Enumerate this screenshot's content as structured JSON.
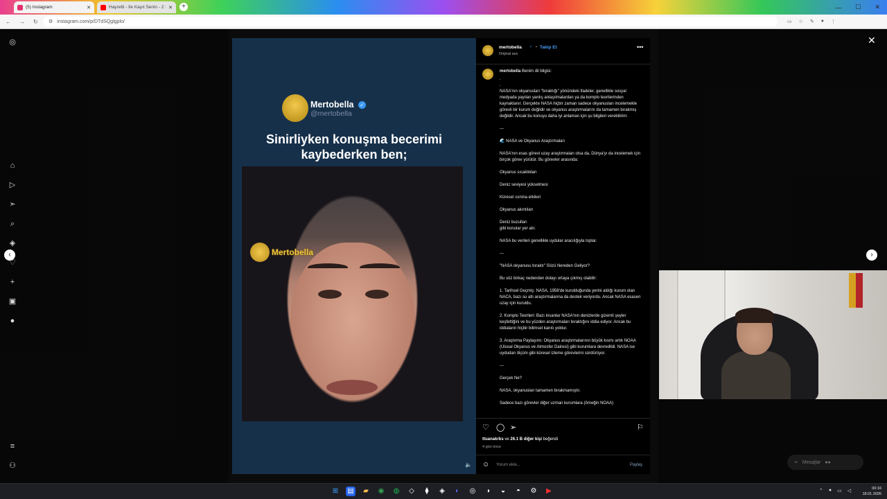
{
  "browser": {
    "tabs": [
      {
        "label": "(5) Instagram",
        "close": "✕",
        "active": true
      },
      {
        "label": "Hayretti - İle Kayıt Senin - 2 Saz...",
        "close": "✕",
        "active": false
      }
    ],
    "new_tab": "+",
    "url": "instagram.com/p/DTdSQglgplo/",
    "window_controls": [
      "—",
      "☐",
      "✕"
    ]
  },
  "post": {
    "media": {
      "profile_name": "Mertobella",
      "profile_handle": "@mertobella",
      "headline_line1": "Sinirliyken konuşma becerimi",
      "headline_line2": "kaybederken ben;",
      "watermark": "Mertobella"
    },
    "header": {
      "username": "mertobella",
      "dot": "•",
      "follow": "Takip Et",
      "audio": "Orijinal ses"
    },
    "caption": {
      "username": "mertobella",
      "intro": "Benim dil bilgisi:",
      "paragraphs": [
        ".",
        ".",
        "NASA'nın okyanusları \"bıraktığı\" yönündeki ifadeler, genellikle sosyal medyada yayılan yanlış anlaşılmalardan ya da komplo teorilerinden kaynaklanır. Gerçekte NASA hiçbir zaman sadece okyanusları incelemekle görevli bir kurum değildir ve okyanus araştırmalarını da tamamen bırakmış değildir. Ancak bu konuyu daha iyi anlaman için şu bilgileri verebilirim:",
        "---",
        "🌊 NASA ve Okyanus Araştırmaları",
        "NASA'nın esas görevi uzay araştırmaları olsa da, Dünya'yı da incelemek için birçok görev yürütür. Bu görevler arasında:",
        "Okyanus sıcaklıkları",
        "Deniz seviyesi yükselmesi",
        "Küresel ısınma etkileri",
        "Okyanus akıntıları",
        "Deniz buzulları\ngibi konular yer alır.",
        "NASA bu verileri genellikle uydular aracılığıyla toplar.",
        "---",
        "\"NASA okyanusu bıraktı\" Sözü Nereden Geliyor?",
        "Bu söz birkaç nedenden dolayı ortaya çıkmış olabilir:",
        "1. Tarihsel Geçmiş: NASA, 1958'de kurulduğunda yerini aldığı kurum olan NACA, bazı su altı araştırmalarına da destek veriyordu. Ancak NASA esasen uzay için kuruldu.",
        "2. Komplo Teorileri: Bazı insanlar NASA'nın denizlerde gizemli şeyler keşfettiğini ve bu yüzden araştırmaları bıraktığını iddia ediyor. Ancak bu iddiaların hiçbir bilimsel kanıtı yoktur.",
        "3. Araştırma Paylaşımı: Okyanus araştırmalarının büyük kısmı artık NOAA (Ulusal Okyanus ve Atmosfer Dairesi) gibi kurumlara devredildi. NASA ise uydudan ölçüm gibi küresel izleme görevlerini sürdürüyor.",
        "---",
        "Gerçek Ne?",
        "NASA, okyanusları tamamen bırakmamıştır.",
        "Sadece bazı görevler diğer uzman kurumlara (örneğin NOAA)"
      ]
    },
    "likes": {
      "user": "ttuanakrbs",
      "conj": "ve",
      "others": "26.1 B diğer kişi",
      "suffix": "beğendi"
    },
    "time_ago": "4 gün önce",
    "comment_placeholder": "Yorum ekle...",
    "share": "Paylaş"
  },
  "messages_pill": "Mesajlar",
  "taskbar": {
    "time": "00:16",
    "date": "18.01.2026"
  },
  "icons": {
    "close": "✕",
    "next": "›",
    "prev": "‹",
    "more": "•••",
    "heart": "♡",
    "comment": "◯",
    "send": "➢",
    "bookmark": "⚐",
    "emoji": "☺",
    "speaker": "🔈",
    "verified": "✓"
  }
}
